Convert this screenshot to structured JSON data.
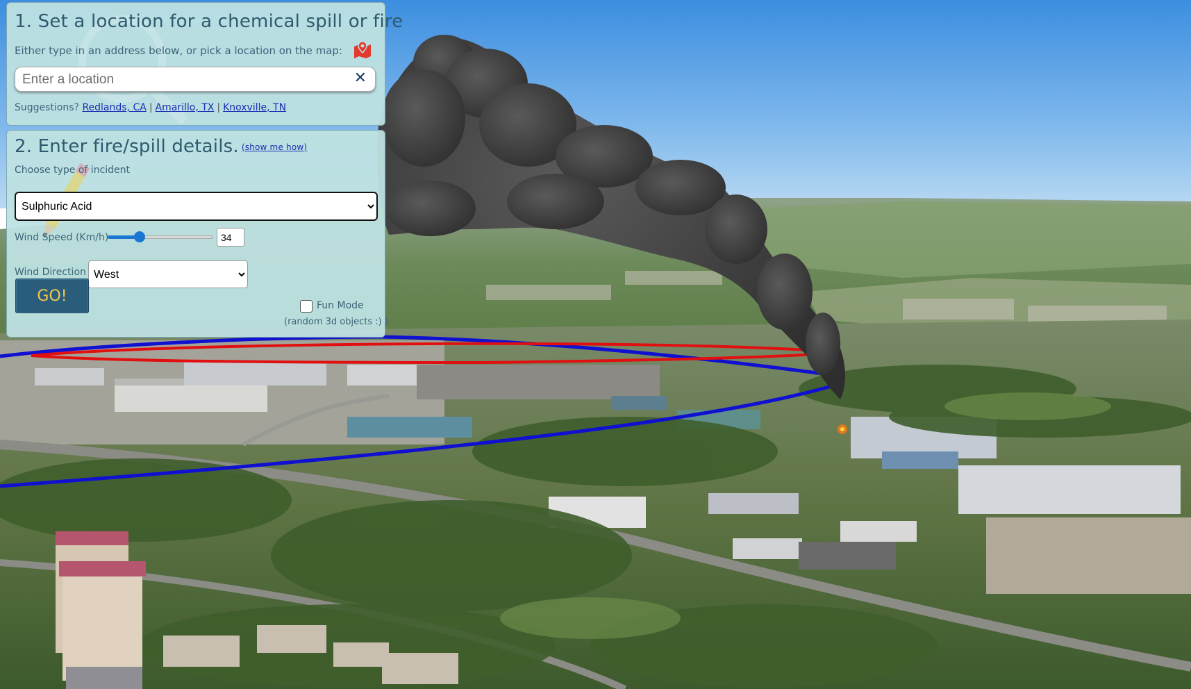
{
  "step1": {
    "title": "1. Set a location for a chemical spill or fire",
    "instruction": "Either type in an address below, or pick a location on the map:",
    "location_placeholder": "Enter a location",
    "clear_symbol": "✕",
    "suggestions_label": "Suggestions?",
    "suggestions": [
      "Redlands, CA",
      "Amarillo, TX",
      "Knoxville, TN"
    ],
    "suggestion_separator": "|",
    "pick_on_map_icon": "map-marker-icon"
  },
  "step2": {
    "title": "2. Enter fire/spill details.",
    "show_me_how": "(show me how)",
    "incident_label": "Choose type of incident",
    "incident_selected": "Sulphuric Acid",
    "wind_speed_label": "Wind Speed (Km/h)",
    "wind_speed_value": "34",
    "wind_speed_slider_fraction": 0.3,
    "wind_direction_label": "Wind Direction",
    "wind_direction_selected": "West",
    "go_label": "GO!",
    "fun_mode_label": "Fun Mode",
    "fun_mode_checked": false,
    "fun_mode_note": "(random 3d objects :) )"
  },
  "colors": {
    "panel_bg": "#bee1e1",
    "title_text": "#2f5a6e",
    "go_button_bg": "#2a5d7c",
    "go_button_text": "#f2c94c",
    "link": "#1a2fb0",
    "plume": "#3a3a3a",
    "zone_red": "#e01010",
    "zone_blue": "#1010d0"
  },
  "map": {
    "view": "3D aerial photo with smoke plume and hazard zone outlines"
  }
}
